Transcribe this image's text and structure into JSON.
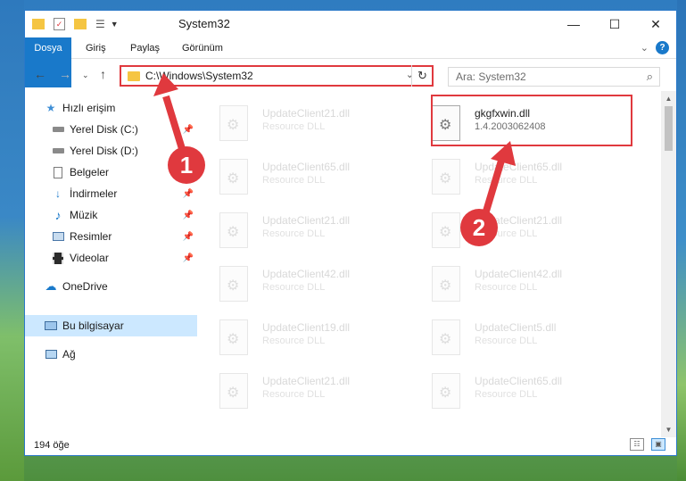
{
  "window": {
    "title": "System32",
    "controls": {
      "minimize": "—",
      "maximize": "☐",
      "close": "✕"
    }
  },
  "ribbon": {
    "tabs": [
      "Dosya",
      "Giriş",
      "Paylaş",
      "Görünüm"
    ]
  },
  "navigation": {
    "address_path": "C:\\Windows\\System32",
    "search_placeholder": "Ara: System32"
  },
  "sidebar": {
    "quick_access": "Hızlı erişim",
    "items": [
      {
        "label": "Yerel Disk (C:)",
        "icon": "drive-icon",
        "pinned": true
      },
      {
        "label": "Yerel Disk (D:)",
        "icon": "drive-icon",
        "pinned": false
      },
      {
        "label": "Belgeler",
        "icon": "documents-icon",
        "pinned": true
      },
      {
        "label": "İndirmeler",
        "icon": "downloads-icon",
        "pinned": true
      },
      {
        "label": "Müzik",
        "icon": "music-icon",
        "pinned": true
      },
      {
        "label": "Resimler",
        "icon": "pictures-icon",
        "pinned": true
      },
      {
        "label": "Videolar",
        "icon": "videos-icon",
        "pinned": true
      }
    ],
    "onedrive": "OneDrive",
    "this_pc": "Bu bilgisayar",
    "network": "Ağ"
  },
  "files": {
    "left": [
      {
        "name": "UpdateClient21.dll",
        "desc": "Resource DLL"
      },
      {
        "name": "UpdateClient65.dll",
        "desc": "Resource DLL"
      },
      {
        "name": "UpdateClient21.dll",
        "desc": "Resource DLL"
      },
      {
        "name": "UpdateClient42.dll",
        "desc": "Resource DLL"
      },
      {
        "name": "UpdateClient19.dll",
        "desc": "Resource DLL"
      },
      {
        "name": "UpdateClient21.dll",
        "desc": "Resource DLL"
      }
    ],
    "right": [
      {
        "name": "gkgfxwin.dll",
        "desc": "1.4.2003062408"
      },
      {
        "name": "UpdateClient65.dll",
        "desc": "Resource DLL"
      },
      {
        "name": "UpdateClient21.dll",
        "desc": "Resource DLL"
      },
      {
        "name": "UpdateClient42.dll",
        "desc": "Resource DLL"
      },
      {
        "name": "UpdateClient5.dll",
        "desc": "Resource DLL"
      },
      {
        "name": "UpdateClient65.dll",
        "desc": "Resource DLL"
      }
    ]
  },
  "status": {
    "item_count": "194 öğe"
  },
  "annotations": {
    "step1": "1",
    "step2": "2",
    "color": "#e0393e"
  }
}
